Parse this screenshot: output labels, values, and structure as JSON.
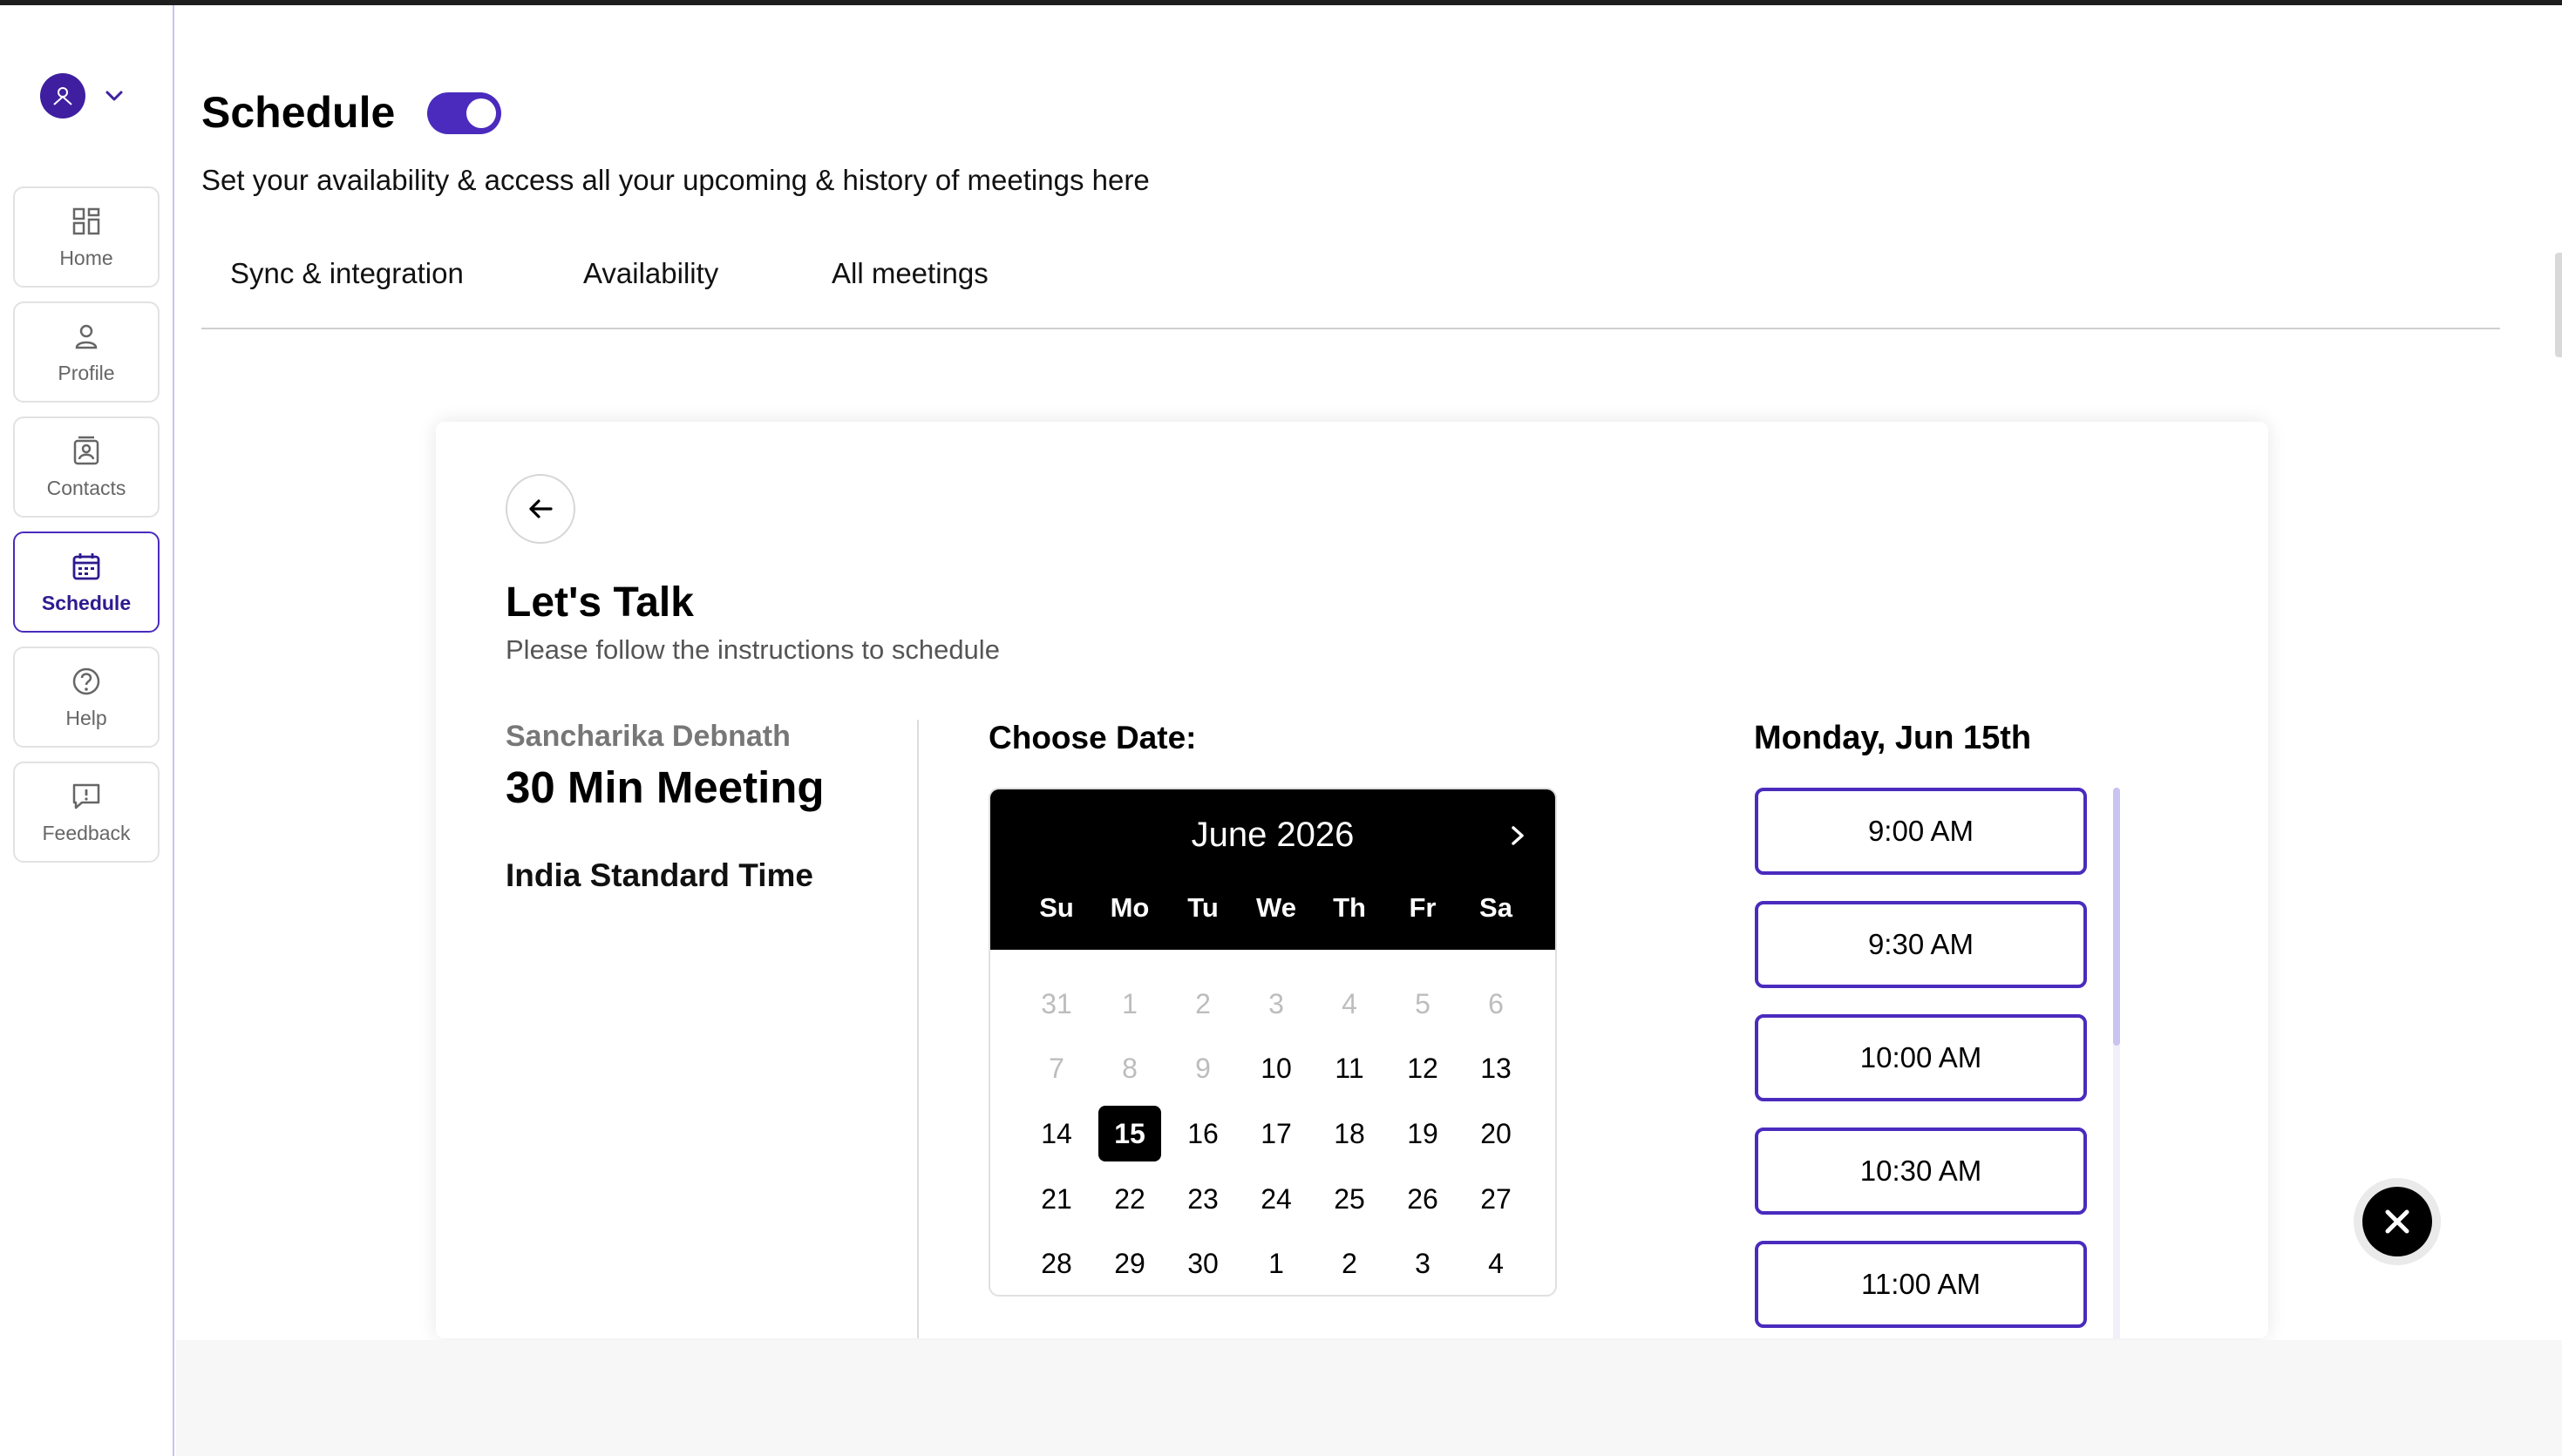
{
  "sidebar": {
    "items": [
      {
        "label": "Home",
        "icon": "dashboard-icon"
      },
      {
        "label": "Profile",
        "icon": "user-icon"
      },
      {
        "label": "Contacts",
        "icon": "contacts-icon"
      },
      {
        "label": "Schedule",
        "icon": "calendar-icon",
        "active": true
      },
      {
        "label": "Help",
        "icon": "help-icon"
      },
      {
        "label": "Feedback",
        "icon": "feedback-icon"
      }
    ]
  },
  "header": {
    "title": "Schedule",
    "toggle_on": true,
    "subtitle": "Set your availability & access all your upcoming & history of meetings here"
  },
  "tabs": [
    "Sync & integration",
    "Availability",
    "All meetings"
  ],
  "card": {
    "title": "Let's Talk",
    "subtitle": "Please follow the instructions to schedule",
    "host": "Sancharika Debnath",
    "meeting": "30 Min Meeting",
    "timezone": "India Standard Time"
  },
  "calendar": {
    "label": "Choose Date:",
    "month": "June 2026",
    "weekdays": [
      "Su",
      "Mo",
      "Tu",
      "We",
      "Th",
      "Fr",
      "Sa"
    ],
    "weeks": [
      [
        "31",
        "1",
        "2",
        "3",
        "4",
        "5",
        "6"
      ],
      [
        "7",
        "8",
        "9",
        "10",
        "11",
        "12",
        "13"
      ],
      [
        "14",
        "15",
        "16",
        "17",
        "18",
        "19",
        "20"
      ],
      [
        "21",
        "22",
        "23",
        "24",
        "25",
        "26",
        "27"
      ],
      [
        "28",
        "29",
        "30",
        "1",
        "2",
        "3",
        "4"
      ]
    ],
    "selected": "15"
  },
  "slots": {
    "date_label": "Monday, Jun 15th",
    "times": [
      "9:00 AM",
      "9:30 AM",
      "10:00 AM",
      "10:30 AM",
      "11:00 AM"
    ]
  },
  "colors": {
    "accent": "#4a2bbd",
    "sidebar_border": "#c9c2f2",
    "calendar_header": "#000000"
  }
}
